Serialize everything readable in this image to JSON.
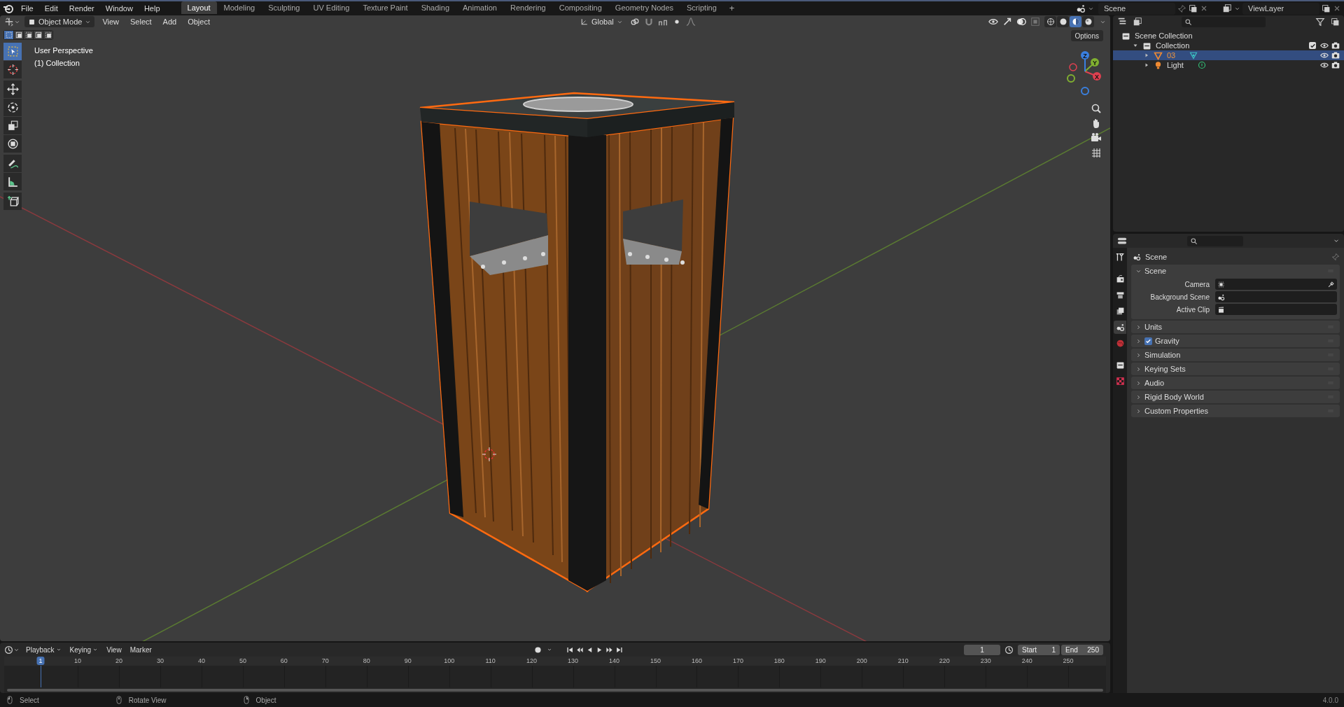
{
  "top_bar": {
    "menus": [
      "File",
      "Edit",
      "Render",
      "Window",
      "Help"
    ],
    "workspaces": [
      {
        "label": "Layout",
        "selected": true
      },
      {
        "label": "Modeling",
        "selected": false
      },
      {
        "label": "Sculpting",
        "selected": false
      },
      {
        "label": "UV Editing",
        "selected": false
      },
      {
        "label": "Texture Paint",
        "selected": false
      },
      {
        "label": "Shading",
        "selected": false
      },
      {
        "label": "Animation",
        "selected": false
      },
      {
        "label": "Rendering",
        "selected": false
      },
      {
        "label": "Compositing",
        "selected": false
      },
      {
        "label": "Geometry Nodes",
        "selected": false
      },
      {
        "label": "Scripting",
        "selected": false
      }
    ],
    "add_tab": "+",
    "scene": "Scene",
    "view_layer": "ViewLayer"
  },
  "viewport_header": {
    "mode": "Object Mode",
    "menus": [
      "View",
      "Select",
      "Add",
      "Object"
    ],
    "orientation": "Global",
    "shading": [
      {
        "kind": "wireframe",
        "selected": false
      },
      {
        "kind": "solid",
        "selected": false
      },
      {
        "kind": "material",
        "selected": true
      },
      {
        "kind": "rendered",
        "selected": false
      }
    ]
  },
  "viewport": {
    "view_name": "User Perspective",
    "collection": "(1) Collection",
    "options": "Options",
    "select_modes": [
      {
        "selected": true
      },
      {
        "selected": false
      },
      {
        "selected": false
      },
      {
        "selected": false
      },
      {
        "selected": false
      }
    ],
    "tools": [
      {
        "kind": "select_box",
        "selected": true
      },
      {
        "kind": "cursor",
        "selected": false
      },
      {
        "kind": "move",
        "selected": false
      },
      {
        "kind": "rotate",
        "selected": false
      },
      {
        "kind": "scale",
        "selected": false
      },
      {
        "kind": "transform",
        "selected": false
      },
      {
        "kind": "annotate",
        "selected": false
      },
      {
        "kind": "measure",
        "selected": false
      },
      {
        "kind": "add_cube",
        "selected": false
      }
    ],
    "gizmo_axes": [
      "X",
      "Y",
      "Z"
    ]
  },
  "outliner": {
    "tree": [
      {
        "label": "Scene Collection",
        "kind": "scene_collection",
        "selected": false,
        "children": [
          {
            "label": "Collection",
            "kind": "collection",
            "selected": false,
            "expanded": true,
            "checked": true,
            "children": [
              {
                "label": "03",
                "kind": "mesh",
                "selected": true,
                "expanded": false
              },
              {
                "label": "Light",
                "kind": "light",
                "selected": false,
                "expanded": false
              }
            ]
          }
        ]
      }
    ]
  },
  "properties": {
    "tabs": [
      {
        "kind": "tool",
        "selected": false
      },
      {
        "kind": "render",
        "selected": false
      },
      {
        "kind": "output",
        "selected": false
      },
      {
        "kind": "view_layer",
        "selected": false
      },
      {
        "kind": "scene",
        "selected": true
      },
      {
        "kind": "world",
        "selected": false
      },
      {
        "kind": "collection",
        "selected": false
      },
      {
        "kind": "texture",
        "selected": false
      }
    ],
    "context": "Scene",
    "panels": [
      {
        "title": "Scene",
        "expanded": true,
        "fields": [
          {
            "label": "Camera",
            "kind": "camera"
          },
          {
            "label": "Background Scene",
            "kind": "scene"
          },
          {
            "label": "Active Clip",
            "kind": "clip"
          }
        ]
      },
      {
        "title": "Units",
        "expanded": false
      },
      {
        "title": "Gravity",
        "expanded": false,
        "checked": true
      },
      {
        "title": "Simulation",
        "expanded": false
      },
      {
        "title": "Keying Sets",
        "expanded": false
      },
      {
        "title": "Audio",
        "expanded": false
      },
      {
        "title": "Rigid Body World",
        "expanded": false
      },
      {
        "title": "Custom Properties",
        "expanded": false
      }
    ]
  },
  "timeline": {
    "menus": [
      "Playback",
      "Keying",
      "View",
      "Marker"
    ],
    "current_frame": "1",
    "start_label": "Start",
    "start": "1",
    "end_label": "End",
    "end": "250",
    "ticks": [
      {
        "label": "1",
        "selected": true
      },
      {
        "label": "10",
        "selected": false
      },
      {
        "label": "20",
        "selected": false
      },
      {
        "label": "30",
        "selected": false
      },
      {
        "label": "40",
        "selected": false
      },
      {
        "label": "50",
        "selected": false
      },
      {
        "label": "60",
        "selected": false
      },
      {
        "label": "70",
        "selected": false
      },
      {
        "label": "80",
        "selected": false
      },
      {
        "label": "90",
        "selected": false
      },
      {
        "label": "100",
        "selected": false
      },
      {
        "label": "110",
        "selected": false
      },
      {
        "label": "120",
        "selected": false
      },
      {
        "label": "130",
        "selected": false
      },
      {
        "label": "140",
        "selected": false
      },
      {
        "label": "150",
        "selected": false
      },
      {
        "label": "160",
        "selected": false
      },
      {
        "label": "170",
        "selected": false
      },
      {
        "label": "180",
        "selected": false
      },
      {
        "label": "190",
        "selected": false
      },
      {
        "label": "200",
        "selected": false
      },
      {
        "label": "210",
        "selected": false
      },
      {
        "label": "220",
        "selected": false
      },
      {
        "label": "230",
        "selected": false
      },
      {
        "label": "240",
        "selected": false
      },
      {
        "label": "250",
        "selected": false
      }
    ]
  },
  "status_bar": {
    "hints": [
      {
        "kind": "left_click",
        "label": "Select"
      },
      {
        "kind": "middle_click",
        "label": "Rotate View"
      },
      {
        "kind": "right_click",
        "label": "Object"
      }
    ],
    "version": "4.0.0"
  }
}
